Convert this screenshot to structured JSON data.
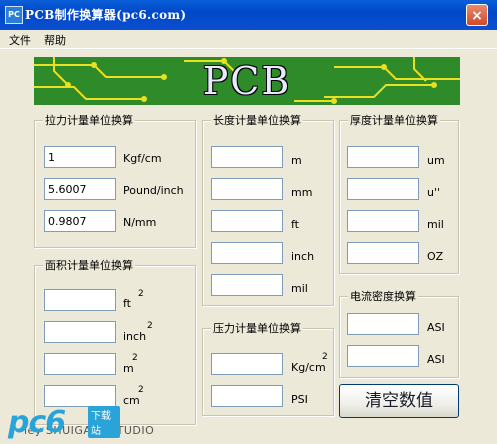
{
  "window": {
    "title": "PCB制作换算器(pc6.com)",
    "icon_label": "PC",
    "close_symbol": "×"
  },
  "menu": {
    "items": [
      "文件",
      "帮助"
    ]
  },
  "banner": {
    "text": "PCB"
  },
  "tension": {
    "title": "拉力计量单位换算",
    "rows": [
      {
        "value": "1",
        "unit": "Kgf/cm"
      },
      {
        "value": "5.6007",
        "unit": "Pound/inch"
      },
      {
        "value": "0.9807",
        "unit": "N/mm"
      }
    ]
  },
  "length": {
    "title": "长度计量单位换算",
    "rows": [
      {
        "value": "",
        "unit": "m"
      },
      {
        "value": "",
        "unit": "mm"
      },
      {
        "value": "",
        "unit": "ft"
      },
      {
        "value": "",
        "unit": "inch"
      },
      {
        "value": "",
        "unit": "mil"
      }
    ]
  },
  "thickness": {
    "title": "厚度计量单位换算",
    "rows": [
      {
        "value": "",
        "unit": "um"
      },
      {
        "value": "",
        "unit": "u''"
      },
      {
        "value": "",
        "unit": "mil"
      },
      {
        "value": "",
        "unit": "OZ"
      }
    ]
  },
  "area": {
    "title": "面积计量单位换算",
    "rows": [
      {
        "value": "",
        "unit": "ft",
        "sup": "2"
      },
      {
        "value": "",
        "unit": "inch",
        "sup": "2"
      },
      {
        "value": "",
        "unit": "m",
        "sup": "2"
      },
      {
        "value": "",
        "unit": "cm",
        "sup": "2"
      }
    ]
  },
  "pressure": {
    "title": "压力计量单位换算",
    "rows": [
      {
        "value": "",
        "unit": "Kg/cm",
        "sup": "2"
      },
      {
        "value": "",
        "unit": "PSI"
      }
    ]
  },
  "current_density": {
    "title": "电流密度换算",
    "rows": [
      {
        "value": "",
        "unit": "ASI"
      },
      {
        "value": "",
        "unit": "ASI"
      }
    ]
  },
  "actions": {
    "clear_label": "清空数值"
  },
  "footer": {
    "text": "ley SHUIGANGSTUDIO"
  },
  "watermark": {
    "logo_text": "pc6",
    "tag_text": "下载站"
  },
  "colors": {
    "titlebar": "#0A4FD0",
    "background": "#ECE9D8",
    "banner_green": "#2f8a2a",
    "watermark_blue": "#2aa3d9"
  }
}
